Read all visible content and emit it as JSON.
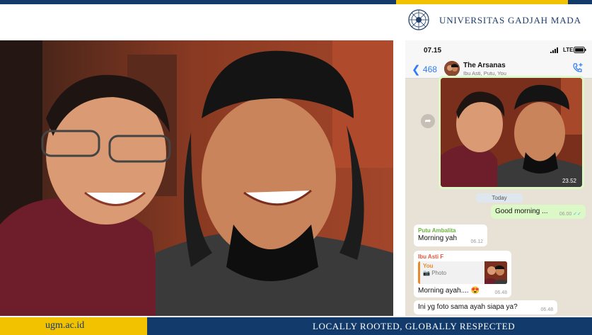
{
  "header": {
    "university_name": "UNIVERSITAS GADJAH MADA"
  },
  "phone": {
    "status_time": "07.15",
    "status_network": "LTE",
    "back_count": "468",
    "chat_title": "The Arsanas",
    "chat_members": "Ibu Asti, Putu, You",
    "image_time": "23.52",
    "date_divider": "Today",
    "messages": [
      {
        "sender": "",
        "text": "Good morning ...",
        "time": "06.00"
      },
      {
        "sender": "Putu Ambalita",
        "text": "Morning yah",
        "time": "06.12"
      },
      {
        "sender": "Ibu Asti F",
        "quote_name": "You",
        "quote_label": "Photo",
        "text": "Morning ayah.... 😍",
        "time": "06.48"
      },
      {
        "sender": "",
        "text": "Ini yg foto sama ayah siapa ya?",
        "time": "06.48"
      }
    ]
  },
  "footer": {
    "site": "ugm.ac.id",
    "tagline": "LOCALLY ROOTED, GLOBALLY RESPECTED"
  },
  "colors": {
    "navy": "#123a6b",
    "gold": "#f2c200",
    "wa_green": "#dcf8c6",
    "ios_blue": "#2f7cf6"
  }
}
